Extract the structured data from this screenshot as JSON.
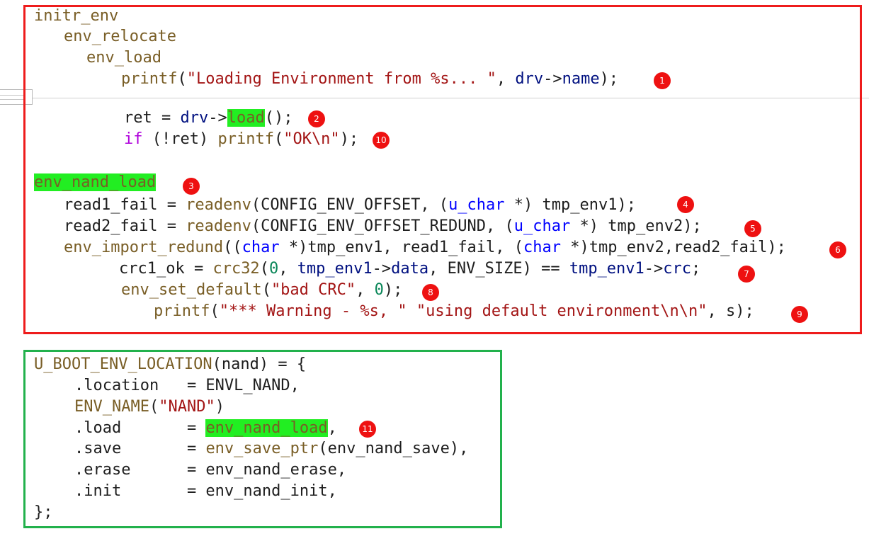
{
  "red_block": {
    "l1": {
      "t": "initr_env"
    },
    "l2": {
      "t": "env_relocate"
    },
    "l3": {
      "t": "env_load"
    },
    "l4": {
      "a": "printf",
      "b": "(",
      "c": "\"Loading Environment from %s... \"",
      "d": ", ",
      "e": "drv",
      "f": "->",
      "g": "name",
      "h": ");"
    },
    "l5": {
      "a": "ret",
      "b": " = ",
      "c": "drv",
      "d": "->",
      "e": "load",
      "f": "();"
    },
    "l6": {
      "a": "if",
      "b": " (!ret) ",
      "c": "printf",
      "d": "(",
      "e": "\"OK\\n\"",
      "f": ");"
    },
    "l7": {
      "t": "env_nand_load"
    },
    "l8": {
      "a": "read1_fail = ",
      "b": "readenv",
      "c": "(CONFIG_ENV_OFFSET, (",
      "d": "u_char",
      "e": " *) tmp_env1);"
    },
    "l9": {
      "a": "read2_fail = ",
      "b": "readenv",
      "c": "(CONFIG_ENV_OFFSET_REDUND, (",
      "d": "u_char",
      "e": " *) tmp_env2);"
    },
    "l10": {
      "a": "env_import_redund",
      "b": "((",
      "c": "char",
      "d": " *)tmp_env1, read1_fail, (",
      "e": "char",
      "f": " *)tmp_env2,read2_fail);"
    },
    "l11": {
      "a": "crc1_ok = ",
      "b": "crc32",
      "c": "(",
      "d": "0",
      "e": ", ",
      "f": "tmp_env1",
      "g": "->",
      "h": "data",
      "i": ", ENV_SIZE) == ",
      "j": "tmp_env1",
      "k": "->",
      "l": "crc",
      "m": ";"
    },
    "l12": {
      "a": "env_set_default",
      "b": "(",
      "c": "\"bad CRC\"",
      "d": ", ",
      "e": "0",
      "f": ");"
    },
    "l13": {
      "a": "printf",
      "b": "(",
      "c": "\"*** Warning - %s, \" \"using default environment\\n\\n\"",
      "d": ", s);"
    }
  },
  "green_block": {
    "l1": {
      "a": "U_BOOT_ENV_LOCATION",
      "b": "(nand) = {"
    },
    "l2": {
      "t": ".location   = ENVL_NAND,"
    },
    "l3": {
      "a": "ENV_NAME",
      "b": "(",
      "c": "\"NAND\"",
      "d": ")"
    },
    "l4": {
      "a": ".load       = ",
      "b": "env_nand_load",
      "c": ","
    },
    "l5": {
      "a": ".save       = ",
      "b": "env_save_ptr",
      "c": "(env_nand_save),"
    },
    "l6": {
      "t": ".erase      = env_nand_erase,"
    },
    "l7": {
      "t": ".init       = env_nand_init,"
    },
    "l8": {
      "t": "};"
    }
  },
  "badges": [
    "1",
    "2",
    "3",
    "4",
    "5",
    "6",
    "7",
    "8",
    "9",
    "10",
    "11"
  ],
  "colors": {
    "red_border": "#ee1c1c",
    "green_border": "#22b14c",
    "highlight": "#22ee22",
    "badge": "#ee1111"
  }
}
